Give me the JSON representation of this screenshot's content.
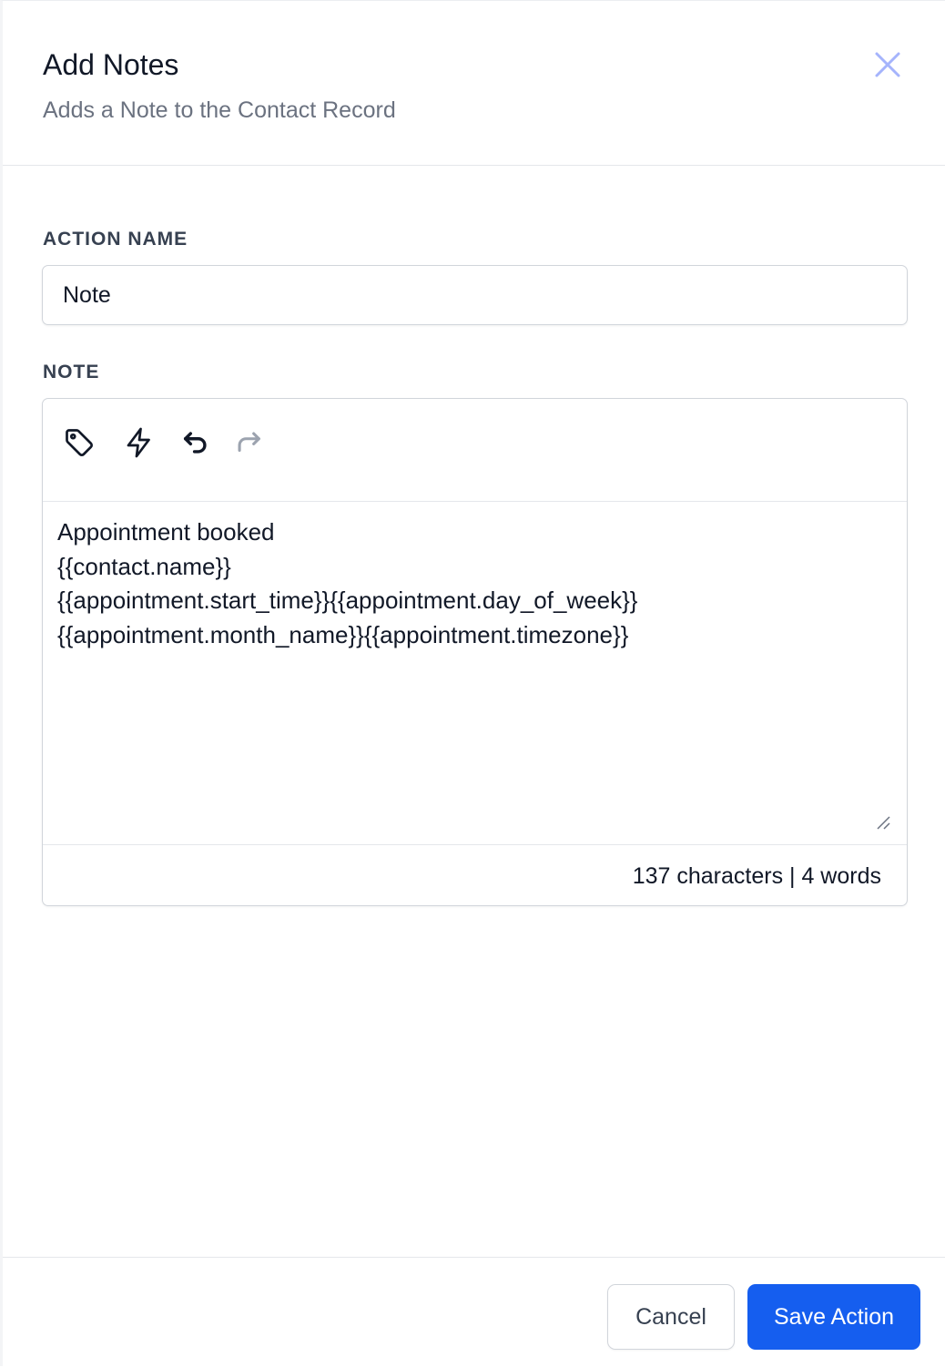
{
  "header": {
    "title": "Add Notes",
    "subtitle": "Adds a Note to the Contact Record",
    "close_icon": "close-icon"
  },
  "action_name": {
    "label": "ACTION NAME",
    "value": "Note"
  },
  "note": {
    "label": "NOTE",
    "toolbar": {
      "icons": [
        "tag-icon",
        "lightning-icon",
        "undo-icon",
        "redo-icon"
      ]
    },
    "body": "Appointment booked\n{{contact.name}}\n{{appointment.start_time}}{{appointment.day_of_week}}\n{{appointment.month_name}}{{appointment.timezone}}",
    "counter": "137 characters | 4 words"
  },
  "footer": {
    "cancel_label": "Cancel",
    "save_label": "Save Action"
  },
  "colors": {
    "primary": "#155eef",
    "close_icon": "#a5b4fc",
    "redo_disabled": "#9ca3af"
  }
}
